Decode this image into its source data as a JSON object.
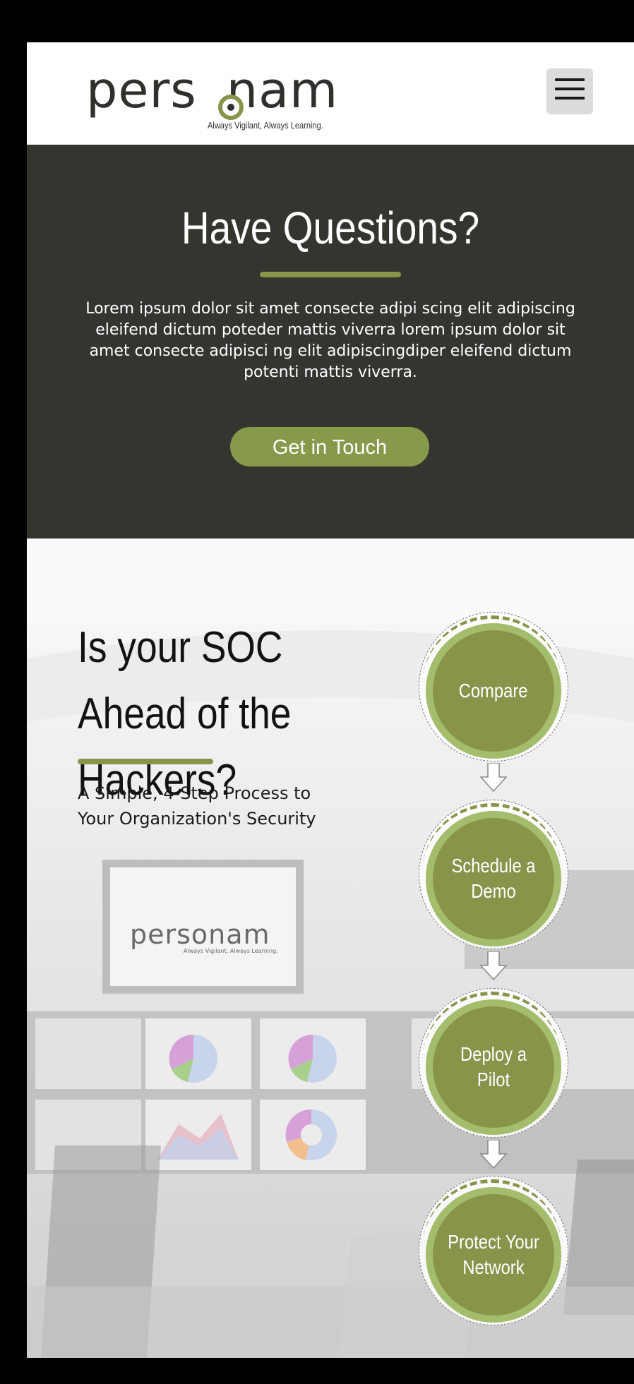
{
  "header": {
    "logo_word": "pers",
    "logo_word_end": "nam",
    "logo_tagline": "Always Vigilant, Always Learning.",
    "menu_icon": "hamburger-icon"
  },
  "questions": {
    "title": "Have Questions?",
    "body": "Lorem ipsum dolor sit amet consecte adipi scing elit adipiscing eleifend dictum poteder mattis viverra lorem ipsum dolor sit amet consecte adipisci ng elit adipiscingdiper eleifend dictum potenti mattis viverra.",
    "cta_label": "Get in Touch"
  },
  "soc": {
    "title": "Is your SOC Ahead of the Hackers?",
    "subtitle": "A Simple, 4-Step Process to Your Organization's Security",
    "steps": [
      {
        "label": "Compare"
      },
      {
        "label": "Schedule a Demo"
      },
      {
        "label": "Deploy a Pilot"
      },
      {
        "label": "Protect Your Network"
      }
    ],
    "background_logo_word": "personam",
    "background_logo_tagline": "Always Vigilant, Always Learning."
  },
  "colors": {
    "accent": "#87944a",
    "dark_section": "#34352f",
    "step_ring": "#a4bd6d"
  }
}
